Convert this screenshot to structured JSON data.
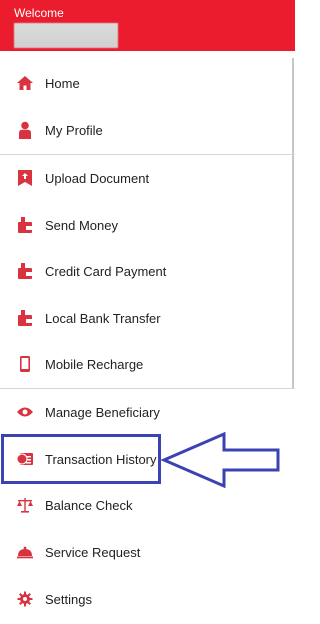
{
  "header": {
    "welcome": "Welcome"
  },
  "menu": [
    {
      "label": "Home",
      "icon": "home-icon"
    },
    {
      "label": "My Profile",
      "icon": "profile-icon"
    },
    {
      "label": "Upload Document",
      "icon": "upload-document-icon"
    },
    {
      "label": "Send Money",
      "icon": "wallet-icon"
    },
    {
      "label": "Credit Card Payment",
      "icon": "wallet-icon"
    },
    {
      "label": "Local Bank Transfer",
      "icon": "wallet-icon"
    },
    {
      "label": "Mobile Recharge",
      "icon": "mobile-icon"
    },
    {
      "label": "Manage Beneficiary",
      "icon": "eye-icon"
    },
    {
      "label": "Transaction History",
      "icon": "transaction-history-icon"
    },
    {
      "label": "Balance Check",
      "icon": "balance-scale-icon"
    },
    {
      "label": "Service Request",
      "icon": "service-bell-icon"
    },
    {
      "label": "Settings",
      "icon": "gear-icon"
    }
  ],
  "colors": {
    "brand_red": "#ea1c2d",
    "highlight_blue": "#3b43b3",
    "icon_red": "#d8333f"
  }
}
